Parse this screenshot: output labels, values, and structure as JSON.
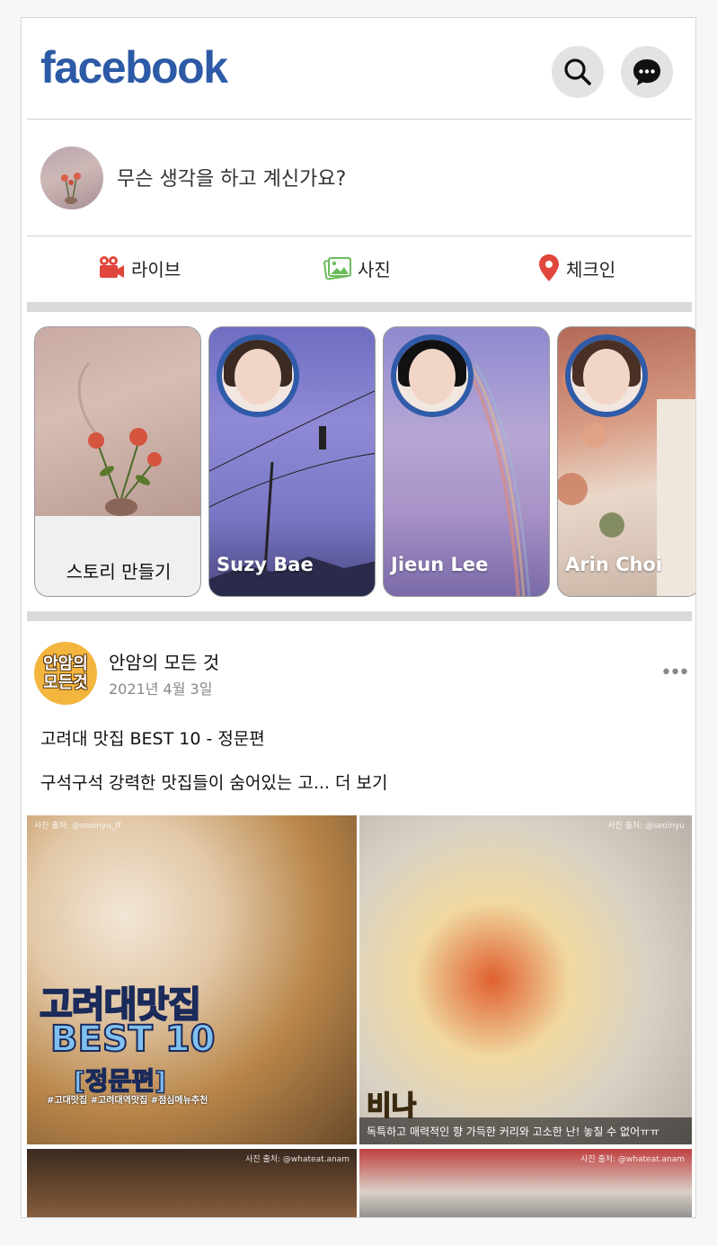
{
  "header": {
    "logo": "facebook"
  },
  "colors": {
    "brand": "#2d5aa6",
    "checkin": "#e0463c",
    "live": "#e0463c",
    "photo": "#6bbd5b"
  },
  "composer": {
    "placeholder": "무슨 생각을 하고 계신가요?"
  },
  "actions": [
    {
      "label": "라이브",
      "icon": "video-camera-icon"
    },
    {
      "label": "사진",
      "icon": "photo-icon"
    },
    {
      "label": "체크인",
      "icon": "location-pin-icon"
    }
  ],
  "stories": {
    "create_label": "스토리 만들기",
    "items": [
      {
        "name": "Suzy Bae"
      },
      {
        "name": "Jieun Lee"
      },
      {
        "name": "Arin Choi"
      }
    ]
  },
  "post": {
    "avatar_text_line1": "안암의",
    "avatar_text_line2": "모든것",
    "author": "안암의 모든 것",
    "date": "2021년 4월 3일",
    "more": "•••",
    "title": "고려대 맛집 BEST 10 - 정문편",
    "body": "구석구석 강력한 맛집들이 숨어있는 고... 더 보기",
    "images": [
      {
        "credit": "사진 출처: @seoinyu_ff",
        "overlay_line1": "고려대맛집",
        "overlay_line2": "BEST 10",
        "overlay_line3": "[정문편]",
        "tags": "#고대맛집 #고려대역맛집 #점심메뉴추천"
      },
      {
        "credit": "사진 출처: @seoinyu",
        "overlay": "비나",
        "caption": "독특하고 매력적인 향 가득한 커리와 고소한 난! 놓칠 수 없어ㅠㅠ"
      },
      {
        "credit": "사진 출처: @whateat.anam"
      },
      {
        "credit": "사진 출처: @whateat.anam"
      }
    ]
  }
}
